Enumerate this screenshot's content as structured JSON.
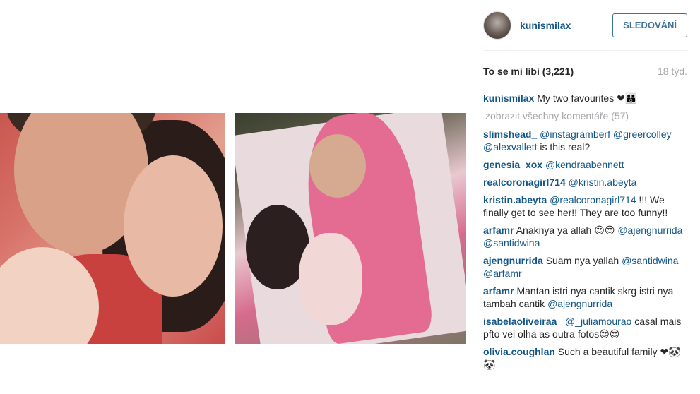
{
  "post": {
    "author": "kunismilax",
    "follow_label": "SLEDOVÁNÍ",
    "likes_label": "To se mi líbí (3,221)",
    "age": "18 týd.",
    "caption_user": "kunismilax",
    "caption_text": "My two favourites ❤👪",
    "view_all_label": "zobrazit všechny komentáře (57)"
  },
  "comments": [
    {
      "user": "slimshead_",
      "parts": [
        {
          "t": "@instagramberf",
          "m": true
        },
        {
          "t": " ",
          "m": false
        },
        {
          "t": "@greercolley",
          "m": true
        },
        {
          "t": " ",
          "m": false
        },
        {
          "t": "@alexvallett",
          "m": true
        },
        {
          "t": " is this real?",
          "m": false
        }
      ]
    },
    {
      "user": "genesia_xox",
      "parts": [
        {
          "t": "@kendraabennett",
          "m": true
        }
      ]
    },
    {
      "user": "realcoronagirl714",
      "parts": [
        {
          "t": "@kristin.abeyta",
          "m": true
        }
      ]
    },
    {
      "user": "kristin.abeyta",
      "parts": [
        {
          "t": "@realcoronagirl714",
          "m": true
        },
        {
          "t": " !!! We finally get to see her!! They are too funny!!",
          "m": false
        }
      ]
    },
    {
      "user": "arfamr",
      "parts": [
        {
          "t": "Anaknya ya allah 😍😍 ",
          "m": false
        },
        {
          "t": "@ajengnurrida",
          "m": true
        },
        {
          "t": " ",
          "m": false
        },
        {
          "t": "@santidwina",
          "m": true
        }
      ]
    },
    {
      "user": "ajengnurrida",
      "parts": [
        {
          "t": "Suam nya yallah ",
          "m": false
        },
        {
          "t": "@santidwina",
          "m": true
        },
        {
          "t": " ",
          "m": false
        },
        {
          "t": "@arfamr",
          "m": true
        }
      ]
    },
    {
      "user": "arfamr",
      "parts": [
        {
          "t": "Mantan istri nya cantik skrg istri nya tambah cantik ",
          "m": false
        },
        {
          "t": "@ajengnurrida",
          "m": true
        }
      ]
    },
    {
      "user": "isabelaoliveiraa_",
      "parts": [
        {
          "t": "@_juliamourao",
          "m": true
        },
        {
          "t": " casal mais pfto vei olha as outra fotos😍😍",
          "m": false
        }
      ]
    },
    {
      "user": "olivia.coughlan",
      "parts": [
        {
          "t": "Such a beautiful family ❤🐼🐼",
          "m": false
        }
      ]
    }
  ]
}
